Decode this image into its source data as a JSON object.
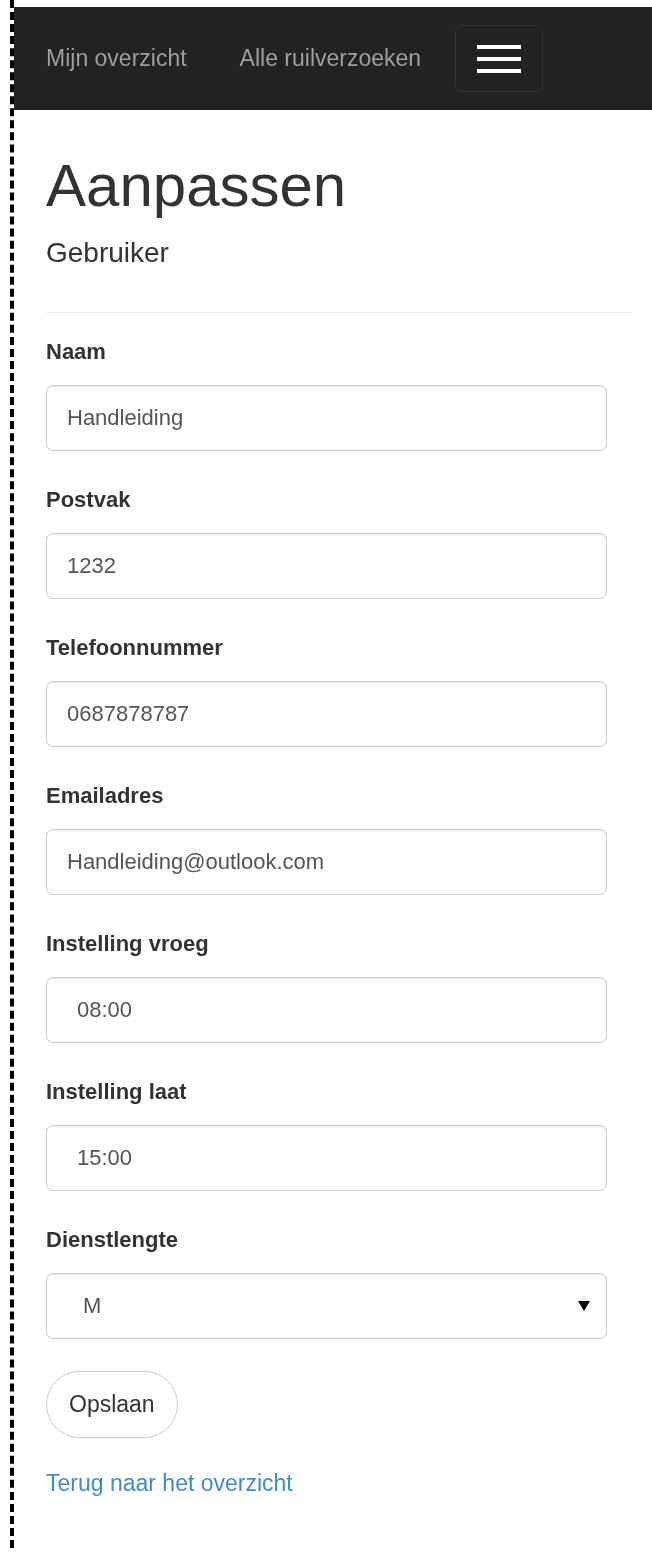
{
  "nav": {
    "links": [
      {
        "label": "Mijn overzicht"
      },
      {
        "label": "Alle ruilverzoeken"
      }
    ]
  },
  "heading": "Aanpassen",
  "subheading": "Gebruiker",
  "fields": [
    {
      "kind": "input",
      "label": "Naam",
      "value": "Handleiding"
    },
    {
      "kind": "input",
      "label": "Postvak",
      "value": "1232"
    },
    {
      "kind": "input",
      "label": "Telefoonnummer",
      "value": "0687878787"
    },
    {
      "kind": "input",
      "label": "Emailadres",
      "value": "Handleiding@outlook.com"
    },
    {
      "kind": "time",
      "label": "Instelling vroeg",
      "value": "08:00"
    },
    {
      "kind": "time",
      "label": "Instelling laat",
      "value": "15:00"
    },
    {
      "kind": "select",
      "label": "Dienstlengte",
      "value": "M"
    }
  ],
  "save_button": "Opslaan",
  "back_link": "Terug naar het overzicht"
}
